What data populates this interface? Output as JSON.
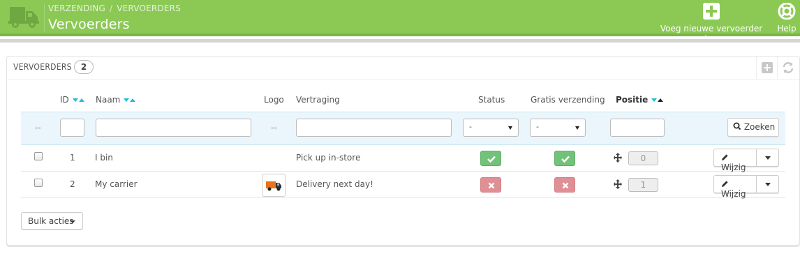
{
  "header": {
    "breadcrumb": [
      "VERZENDING",
      "VERVOERDERS"
    ],
    "title": "Vervoerders",
    "add_label": "Voeg nieuwe vervoerder toe",
    "help_label": "Help",
    "icon": "truck-icon"
  },
  "panel": {
    "title": "VERVOERDERS",
    "count": "2"
  },
  "table": {
    "columns": [
      "ID",
      "Naam",
      "Logo",
      "Vertraging",
      "Status",
      "Gratis verzending",
      "Positie"
    ],
    "filter": {
      "bulk_placeholder": "--",
      "logo_placeholder": "--",
      "status_value": "-",
      "free_value": "-",
      "search_label": "Zoeken"
    },
    "rows": [
      {
        "id": "1",
        "name": "I bin",
        "delay": "Pick up in-store",
        "status": "enabled",
        "free_shipping": "enabled",
        "position": "0",
        "has_logo": false
      },
      {
        "id": "2",
        "name": "My carrier",
        "delay": "Delivery next day!",
        "status": "disabled",
        "free_shipping": "disabled",
        "position": "1",
        "has_logo": true
      }
    ],
    "edit_label": "Wijzig",
    "bulk_label": "Bulk acties"
  },
  "colors": {
    "header_bg": "#8bc954",
    "accent": "#25b9d7",
    "status_ok": "#72c279",
    "status_no": "#e08f95"
  }
}
